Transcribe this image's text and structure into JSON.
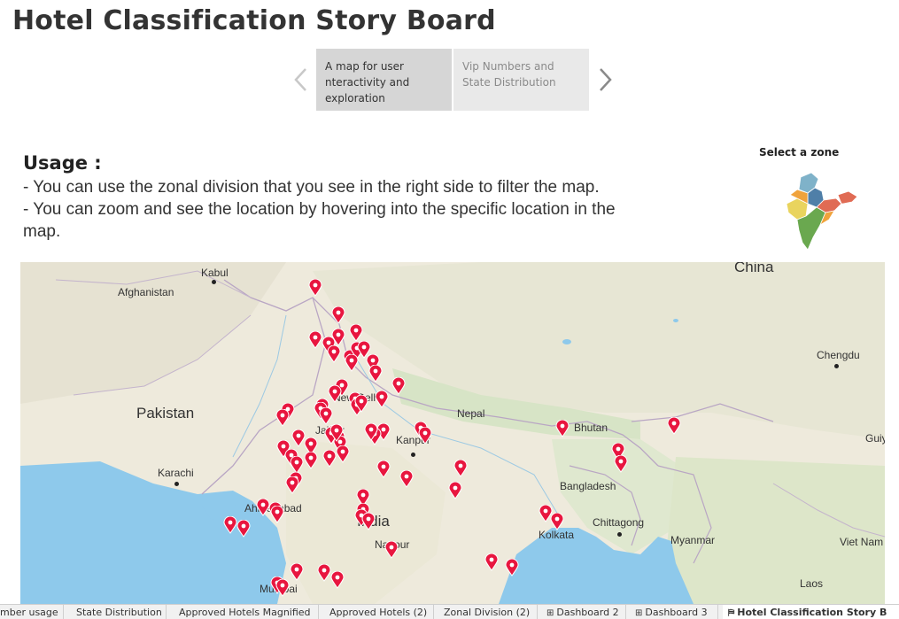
{
  "page": {
    "title": "Hotel Classification Story Board"
  },
  "story": {
    "points": [
      {
        "label": "A map for user nteractivity and exploration",
        "selected": true
      },
      {
        "label": "Vip Numbers and State Distribution",
        "selected": false
      }
    ],
    "prev_icon": "chevron-left-icon",
    "next_icon": "chevron-right-icon"
  },
  "usage": {
    "heading": "Usage :",
    "lines": [
      "- You can use the zonal division that you see in the right side to filter the map.",
      "- You can zoom and see the location by hovering into the specific location in the",
      "map."
    ]
  },
  "zone_filter": {
    "title": "Select  a zone",
    "zone_colors": [
      "#7fb2c9",
      "#4f7fa8",
      "#e06b54",
      "#f0a33c",
      "#e9d45e",
      "#6aa84f"
    ]
  },
  "map": {
    "labels": {
      "china": "China",
      "kabul": "Kabul",
      "afghanistan": "Afghanistan",
      "pakistan": "Pakistan",
      "new_delhi": "New Delhi",
      "jaipur": "Jaipur",
      "kanpur": "Kanpur",
      "nepal": "Nepal",
      "bhutan": "Bhutan",
      "chengdu": "Chengdu",
      "gui": "Guiy",
      "karachi": "Karachi",
      "bangladesh": "Bangladesh",
      "ahmedabad": "Ahmedabad",
      "india": "India",
      "chittagong": "Chittagong",
      "kolkata": "Kolkata",
      "nagpur": "Nagpur",
      "myanmar": "Myanmar",
      "viet_nam": "Viet Nam",
      "mumbai": "Mumbai",
      "laos": "Laos"
    },
    "marker_color": "#e8163f",
    "marker_icon": "location-pin-icon"
  },
  "tabs": [
    {
      "label": "mber usage",
      "icon": ""
    },
    {
      "label": "State Distribution",
      "icon": ""
    },
    {
      "label": "Approved Hotels Magnified",
      "icon": ""
    },
    {
      "label": "Approved Hotels (2)",
      "icon": ""
    },
    {
      "label": "Zonal Division (2)",
      "icon": ""
    },
    {
      "label": "Dashboard 2",
      "icon": "⊞"
    },
    {
      "label": "Dashboard 3",
      "icon": "⊞"
    },
    {
      "label": "Hotel Classification Story B",
      "icon": "⛿",
      "active": true
    }
  ]
}
